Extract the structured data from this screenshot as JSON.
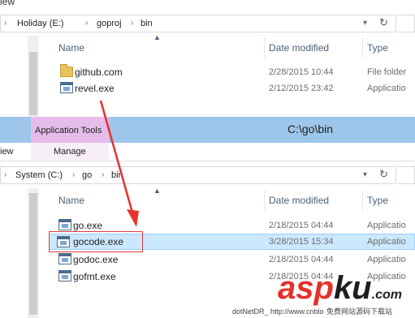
{
  "colors": {
    "accent": "#9dc6ea",
    "ribbon_pink": "#e6bdea",
    "selection": "#cce8ff",
    "selection_border": "#99d1ff",
    "arrow": "#e8312d",
    "highlight_box": "#e03b3b"
  },
  "top_window": {
    "title_partial": "iew",
    "address": {
      "crumbs": [
        "Holiday (E:)",
        "goproj",
        "bin"
      ],
      "refresh_icon": "refresh-icon"
    },
    "columns": {
      "name": "Name",
      "modified": "Date modified",
      "type": "Type"
    },
    "files": [
      {
        "name": "github.com",
        "modified": "2/28/2015 10:44",
        "type": "File folder",
        "icon": "folder-icon"
      },
      {
        "name": "revel.exe",
        "modified": "2/12/2015 23:42",
        "type": "Applicatio",
        "icon": "exe-icon"
      }
    ]
  },
  "ribbon": {
    "context_tab": "Application Tools",
    "window_title": "C:\\go\\bin",
    "tab_view": "iew",
    "tab_manage": "Manage"
  },
  "bottom_window": {
    "address": {
      "crumbs": [
        "System (C:)",
        "go",
        "bin"
      ]
    },
    "columns": {
      "name": "Name",
      "modified": "Date modified",
      "type": "Type"
    },
    "files": [
      {
        "name": "go.exe",
        "modified": "2/18/2015 04:44",
        "type": "Applicatio",
        "selected": false
      },
      {
        "name": "gocode.exe",
        "modified": "3/28/2015 15:34",
        "type": "Applicatio",
        "selected": true
      },
      {
        "name": "godoc.exe",
        "modified": "2/18/2015 04:44",
        "type": "Applicatio",
        "selected": false
      },
      {
        "name": "gofmt.exe",
        "modified": "2/18/2015 04:44",
        "type": "Applicatio",
        "selected": false
      }
    ]
  },
  "watermark": {
    "logo_asp": "asp",
    "logo_ku": "ku",
    "logo_com": ".com",
    "footer_text": "dotNetDR_ http://www.cnblo",
    "footer_text_2": "免费网站源码下载站"
  }
}
